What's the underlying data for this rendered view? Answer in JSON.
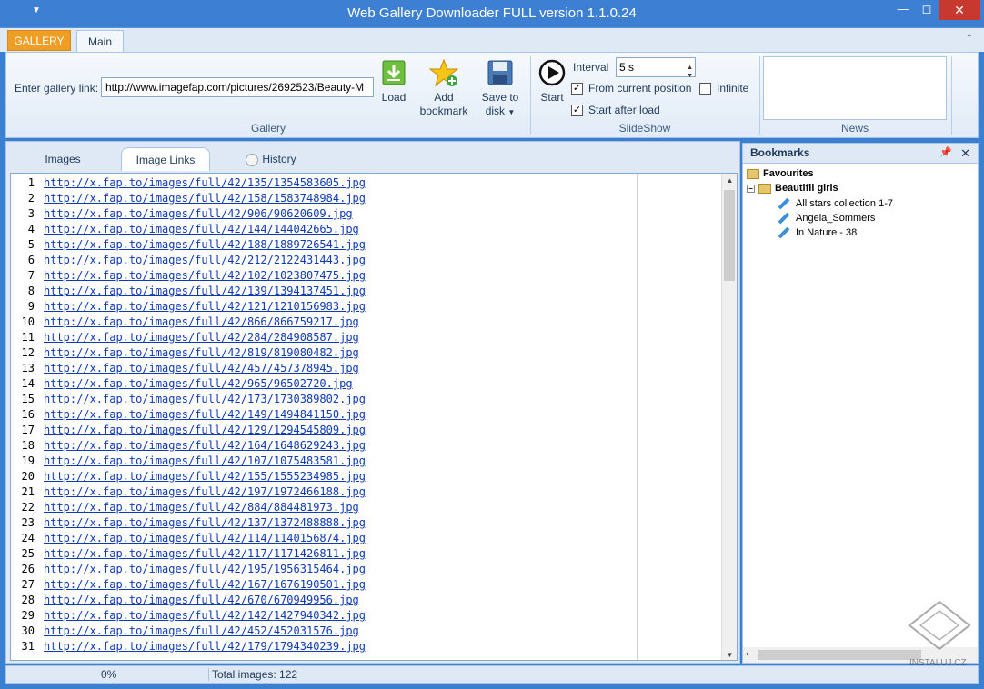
{
  "window": {
    "title": "Web Gallery Downloader FULL version 1.1.0.24"
  },
  "ribbon_tabs": {
    "gallery": "GALLERY",
    "main": "Main"
  },
  "gallery_group": {
    "link_label": "Enter gallery link:",
    "link_value": "http://www.imagefap.com/pictures/2692523/Beauty-M",
    "load": "Load",
    "add_bookmark_1": "Add",
    "add_bookmark_2": "bookmark",
    "save_1": "Save to",
    "save_2": "disk",
    "group_name": "Gallery"
  },
  "slideshow_group": {
    "start": "Start",
    "interval_label": "Interval",
    "interval_value": "5 s",
    "from_current": "From current position",
    "from_current_checked": true,
    "infinite": "Infinite",
    "infinite_checked": false,
    "start_after_load": "Start after load",
    "start_after_load_checked": true,
    "group_name": "SlideShow"
  },
  "news_group": {
    "group_name": "News"
  },
  "doc_tabs": {
    "images": "Images",
    "image_links": "Image Links",
    "history": "History"
  },
  "links": [
    {
      "n": "1",
      "url": "http://x.fap.to/images/full/42/135/1354583605.jpg"
    },
    {
      "n": "2",
      "url": "http://x.fap.to/images/full/42/158/1583748984.jpg"
    },
    {
      "n": "3",
      "url": "http://x.fap.to/images/full/42/906/90620609.jpg"
    },
    {
      "n": "4",
      "url": "http://x.fap.to/images/full/42/144/144042665.jpg"
    },
    {
      "n": "5",
      "url": "http://x.fap.to/images/full/42/188/1889726541.jpg"
    },
    {
      "n": "6",
      "url": "http://x.fap.to/images/full/42/212/2122431443.jpg"
    },
    {
      "n": "7",
      "url": "http://x.fap.to/images/full/42/102/1023807475.jpg"
    },
    {
      "n": "8",
      "url": "http://x.fap.to/images/full/42/139/1394137451.jpg"
    },
    {
      "n": "9",
      "url": "http://x.fap.to/images/full/42/121/1210156983.jpg"
    },
    {
      "n": "10",
      "url": "http://x.fap.to/images/full/42/866/866759217.jpg"
    },
    {
      "n": "11",
      "url": "http://x.fap.to/images/full/42/284/284908587.jpg"
    },
    {
      "n": "12",
      "url": "http://x.fap.to/images/full/42/819/819080482.jpg"
    },
    {
      "n": "13",
      "url": "http://x.fap.to/images/full/42/457/457378945.jpg"
    },
    {
      "n": "14",
      "url": "http://x.fap.to/images/full/42/965/96502720.jpg"
    },
    {
      "n": "15",
      "url": "http://x.fap.to/images/full/42/173/1730389802.jpg"
    },
    {
      "n": "16",
      "url": "http://x.fap.to/images/full/42/149/1494841150.jpg"
    },
    {
      "n": "17",
      "url": "http://x.fap.to/images/full/42/129/1294545809.jpg"
    },
    {
      "n": "18",
      "url": "http://x.fap.to/images/full/42/164/1648629243.jpg"
    },
    {
      "n": "19",
      "url": "http://x.fap.to/images/full/42/107/1075483581.jpg"
    },
    {
      "n": "20",
      "url": "http://x.fap.to/images/full/42/155/1555234985.jpg"
    },
    {
      "n": "21",
      "url": "http://x.fap.to/images/full/42/197/1972466188.jpg"
    },
    {
      "n": "22",
      "url": "http://x.fap.to/images/full/42/884/884481973.jpg"
    },
    {
      "n": "23",
      "url": "http://x.fap.to/images/full/42/137/1372488888.jpg"
    },
    {
      "n": "24",
      "url": "http://x.fap.to/images/full/42/114/1140156874.jpg"
    },
    {
      "n": "25",
      "url": "http://x.fap.to/images/full/42/117/1171426811.jpg"
    },
    {
      "n": "26",
      "url": "http://x.fap.to/images/full/42/195/1956315464.jpg"
    },
    {
      "n": "27",
      "url": "http://x.fap.to/images/full/42/167/1676190501.jpg"
    },
    {
      "n": "28",
      "url": "http://x.fap.to/images/full/42/670/670949956.jpg"
    },
    {
      "n": "29",
      "url": "http://x.fap.to/images/full/42/142/1427940342.jpg"
    },
    {
      "n": "30",
      "url": "http://x.fap.to/images/full/42/452/452031576.jpg"
    },
    {
      "n": "31",
      "url": "http://x.fap.to/images/full/42/179/1794340239.jpg"
    }
  ],
  "bookmarks": {
    "title": "Bookmarks",
    "root": "Favourites",
    "folder": "Beautifil girls",
    "items": [
      "All stars collection 1-7",
      "Angela_Sommers",
      "In Nature - 38"
    ]
  },
  "status": {
    "progress": "0%",
    "total": "Total images: 122"
  },
  "watermark": {
    "text": "INSTALUJ.CZ"
  }
}
